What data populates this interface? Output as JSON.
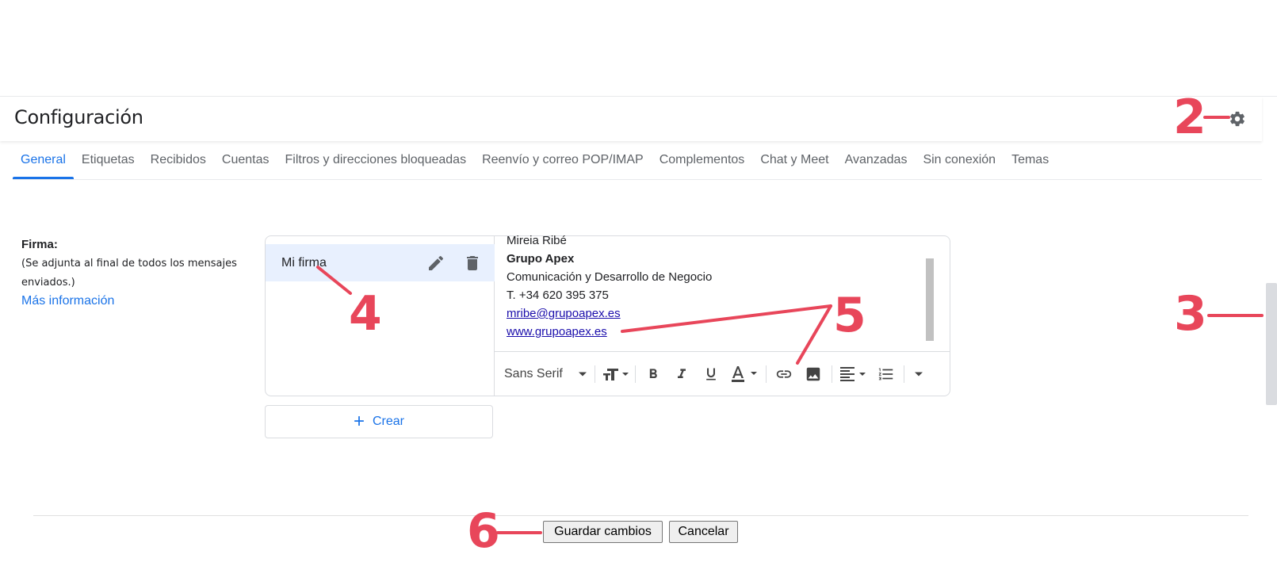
{
  "header": {
    "title": "Configuración"
  },
  "tabs": [
    {
      "label": "General",
      "active": true
    },
    {
      "label": "Etiquetas"
    },
    {
      "label": "Recibidos"
    },
    {
      "label": "Cuentas"
    },
    {
      "label": "Filtros y direcciones bloqueadas"
    },
    {
      "label": "Reenvío y correo POP/IMAP"
    },
    {
      "label": "Complementos"
    },
    {
      "label": "Chat y Meet"
    },
    {
      "label": "Avanzadas"
    },
    {
      "label": "Sin conexión"
    },
    {
      "label": "Temas"
    }
  ],
  "signature_section": {
    "label": "Firma:",
    "description": "(Se adjunta al final de todos los mensajes enviados.)",
    "more_info": "Más información",
    "signatures": [
      {
        "name": "Mi firma"
      }
    ],
    "create_label": "Crear",
    "content": {
      "name": "Mireia Ribé",
      "company": "Grupo Apex",
      "department": "Comunicación y Desarrollo de Negocio",
      "phone": "T. +34 620 395 375",
      "email": "mribe@grupoapex.es",
      "website": "www.grupoapex.es"
    },
    "toolbar": {
      "font": "Sans Serif"
    }
  },
  "footer": {
    "save_label": "Guardar cambios",
    "cancel_label": "Cancelar"
  },
  "annotations": [
    "2",
    "3",
    "4",
    "5",
    "6"
  ],
  "colors": {
    "accent": "#1a73e8",
    "annotation": "#e8465a",
    "selected_bg": "#e8f0fe"
  }
}
